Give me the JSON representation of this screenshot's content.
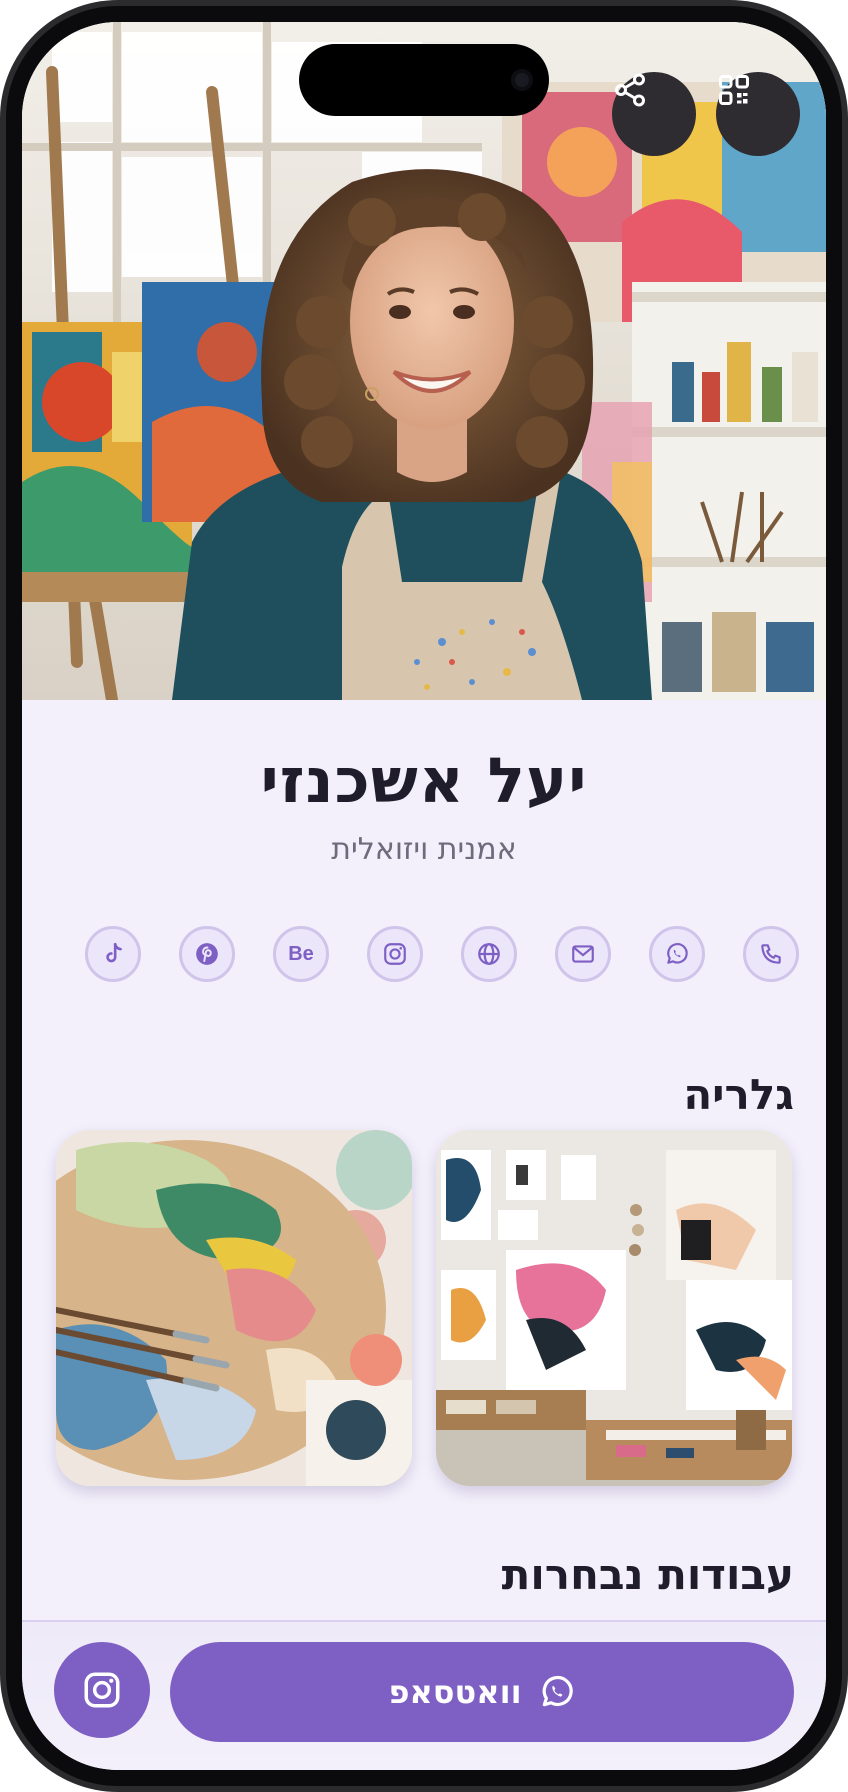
{
  "profile": {
    "name": "יעל אשכנזי",
    "title": "אמנית ויזואלית"
  },
  "header_actions": [
    {
      "icon": "share-icon"
    },
    {
      "icon": "qr-code-icon"
    }
  ],
  "contact_icons": [
    {
      "icon": "tiktok-icon"
    },
    {
      "icon": "pinterest-icon"
    },
    {
      "icon": "behance-icon",
      "text": "Be"
    },
    {
      "icon": "instagram-icon"
    },
    {
      "icon": "globe-icon"
    },
    {
      "icon": "mail-icon"
    },
    {
      "icon": "whatsapp-icon"
    },
    {
      "icon": "phone-icon"
    }
  ],
  "sections": {
    "gallery": "גלריה",
    "featured": "עבודות נבחרות"
  },
  "bottom_bar": {
    "whatsapp_label": "וואטסאפ",
    "instagram_icon": "instagram-icon"
  },
  "colors": {
    "accent": "#7e5fc4",
    "background": "#f3f0fb",
    "text": "#1f1d2b"
  }
}
